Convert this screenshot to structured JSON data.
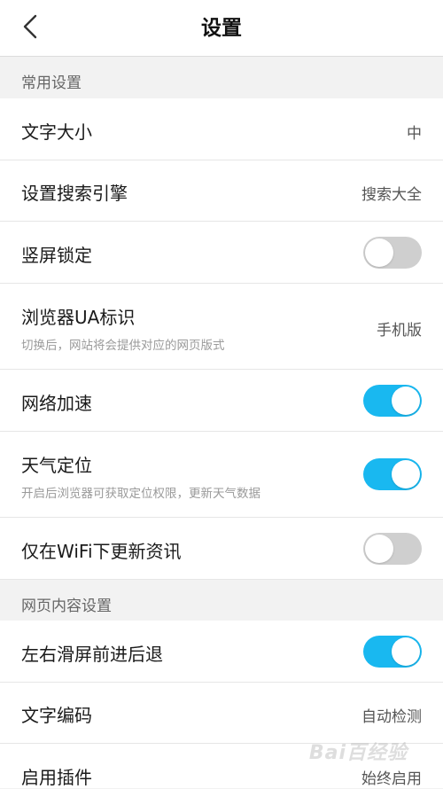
{
  "header": {
    "title": "设置",
    "back_icon": "chevron-left-icon"
  },
  "sections": [
    {
      "title": "常用设置"
    },
    {
      "title": "网页内容设置"
    }
  ],
  "rows": {
    "font_size": {
      "label": "文字大小",
      "value": "中"
    },
    "search_engine": {
      "label": "设置搜索引擎",
      "value": "搜索大全"
    },
    "portrait_lock": {
      "label": "竖屏锁定",
      "toggle": false
    },
    "browser_ua": {
      "label": "浏览器UA标识",
      "subtitle": "切换后，网站将会提供对应的网页版式",
      "value": "手机版"
    },
    "network_accel": {
      "label": "网络加速",
      "toggle": true
    },
    "weather_location": {
      "label": "天气定位",
      "subtitle": "开启后浏览器可获取定位权限，更新天气数据",
      "toggle": true
    },
    "wifi_only_news": {
      "label": "仅在WiFi下更新资讯",
      "toggle": false
    },
    "swipe_nav": {
      "label": "左右滑屏前进后退",
      "toggle": true
    },
    "text_encoding": {
      "label": "文字编码",
      "value": "自动检测"
    },
    "plugins": {
      "label": "启用插件",
      "value": "始终启用"
    }
  },
  "colors": {
    "toggle_on": "#19b8f0",
    "toggle_off": "#cfcfcf",
    "background": "#f2f2f2"
  },
  "watermark": "Bai百经验"
}
